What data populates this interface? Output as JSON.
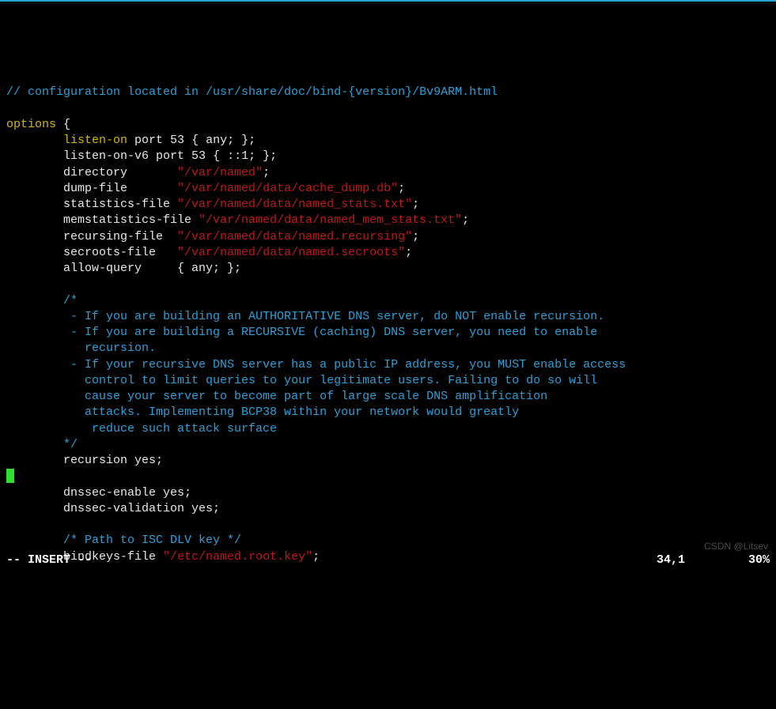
{
  "top_comment": "// configuration located in /usr/share/doc/bind-{version}/Bv9ARM.html",
  "options_kw": "options",
  "brace_open": " {",
  "lines": {
    "listen_on": {
      "key": "listen-on",
      "rest": " port ",
      "num": "53",
      "tail": " { any; };"
    },
    "listen_on_v6": {
      "key": "listen-on-v6 port ",
      "num": "53",
      "tail": " { ::1; };"
    },
    "directory": {
      "key": "directory       ",
      "str": "\"/var/named\"",
      "tail": ";"
    },
    "dump_file": {
      "key": "dump-file       ",
      "str": "\"/var/named/data/cache_dump.db\"",
      "tail": ";"
    },
    "stats_file": {
      "key": "statistics-file ",
      "str": "\"/var/named/data/named_stats.txt\"",
      "tail": ";"
    },
    "memstats": {
      "key": "memstatistics-file ",
      "str": "\"/var/named/data/named_mem_stats.txt\"",
      "tail": ";"
    },
    "recursing": {
      "key": "recursing-file  ",
      "str": "\"/var/named/data/named.recursing\"",
      "tail": ";"
    },
    "secroots": {
      "key": "secroots-file   ",
      "str": "\"/var/named/data/named.secroots\"",
      "tail": ";"
    },
    "allow_query": {
      "key": "allow-query     { any; };"
    },
    "recursion": {
      "key": "recursion yes;"
    },
    "dnssec_enable": {
      "key": "dnssec-enable yes;"
    },
    "dnssec_valid": {
      "key": "dnssec-validation yes;"
    },
    "bindkeys": {
      "key": "bindkeys-file ",
      "str": "\"/etc/named.root.key\"",
      "tail": ";"
    }
  },
  "block_comment": {
    "open": "/*",
    "l1": " - If you are building an AUTHORITATIVE DNS server, do NOT enable recursion.",
    "l2": " - If you are building a RECURSIVE (caching) DNS server, you need to enable",
    "l2b": "   recursion.",
    "l3": " - If your recursive DNS server has a public IP address, you MUST enable access",
    "l3b": "   control to limit queries to your legitimate users. Failing to do so will",
    "l3c": "   cause your server to become part of large scale DNS amplification",
    "l3d": "   attacks. Implementing BCP38 within your network would greatly",
    "l3e": "    reduce such attack surface",
    "close": "*/"
  },
  "path_comment": "/* Path to ISC DLV key */",
  "status": {
    "mode": "-- INSERT --",
    "pos": "34,1",
    "pct": "30%"
  },
  "watermark": "CSDN @Litsev"
}
